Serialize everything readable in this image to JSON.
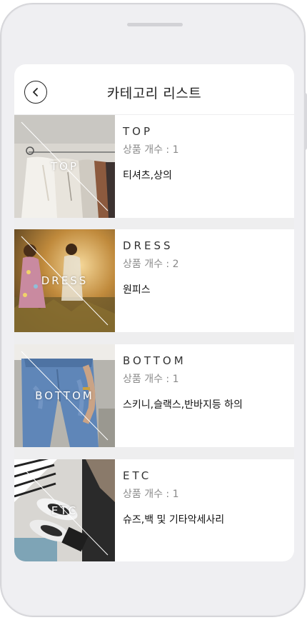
{
  "header": {
    "title": "카테고리 리스트"
  },
  "categories": [
    {
      "thumb_label": "TOP",
      "name": "TOP",
      "count_text": "상품 개수 : 1",
      "desc": "티셔츠,상의"
    },
    {
      "thumb_label": "DRESS",
      "name": "DRESS",
      "count_text": "상품 개수 : 2",
      "desc": "원피스"
    },
    {
      "thumb_label": "BOTTOM",
      "name": "BOTTOM",
      "count_text": "상품 개수 : 1",
      "desc": "스키니,슬랙스,반바지등 하의"
    },
    {
      "thumb_label": "ETC",
      "name": "ETC",
      "count_text": "상품 개수 : 1",
      "desc": "슈즈,백 및 기타악세사리"
    }
  ]
}
